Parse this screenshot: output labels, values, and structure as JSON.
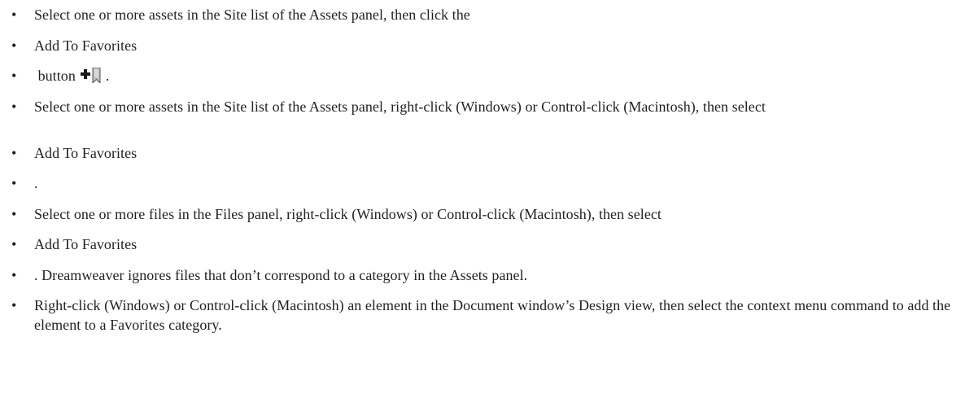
{
  "bullets": [
    {
      "text": "Select one or more assets in the Site list of the Assets panel, then click the"
    },
    {
      "text": "Add To Favorites"
    },
    {
      "text_before": "button",
      "icon": "add-to-favorites-icon",
      "text_after": "."
    },
    {
      "text": "Select one or more assets in the Site list of the Assets panel, right-click (Windows) or Control-click (Macintosh), then select"
    },
    {
      "text": "Add To Favorites"
    },
    {
      "text": "."
    },
    {
      "text": "Select one or more files in the Files panel, right-click (Windows) or Control-click (Macintosh), then select"
    },
    {
      "text": "Add To Favorites"
    },
    {
      "text": ". Dreamweaver ignores files that don’t correspond to a category in the Assets panel."
    },
    {
      "text": "Right-click (Windows) or Control-click (Macintosh) an element in the Document window’s Design view, then select the context menu command to add the element to a Favorites category."
    }
  ],
  "bullet_glyph": "•"
}
